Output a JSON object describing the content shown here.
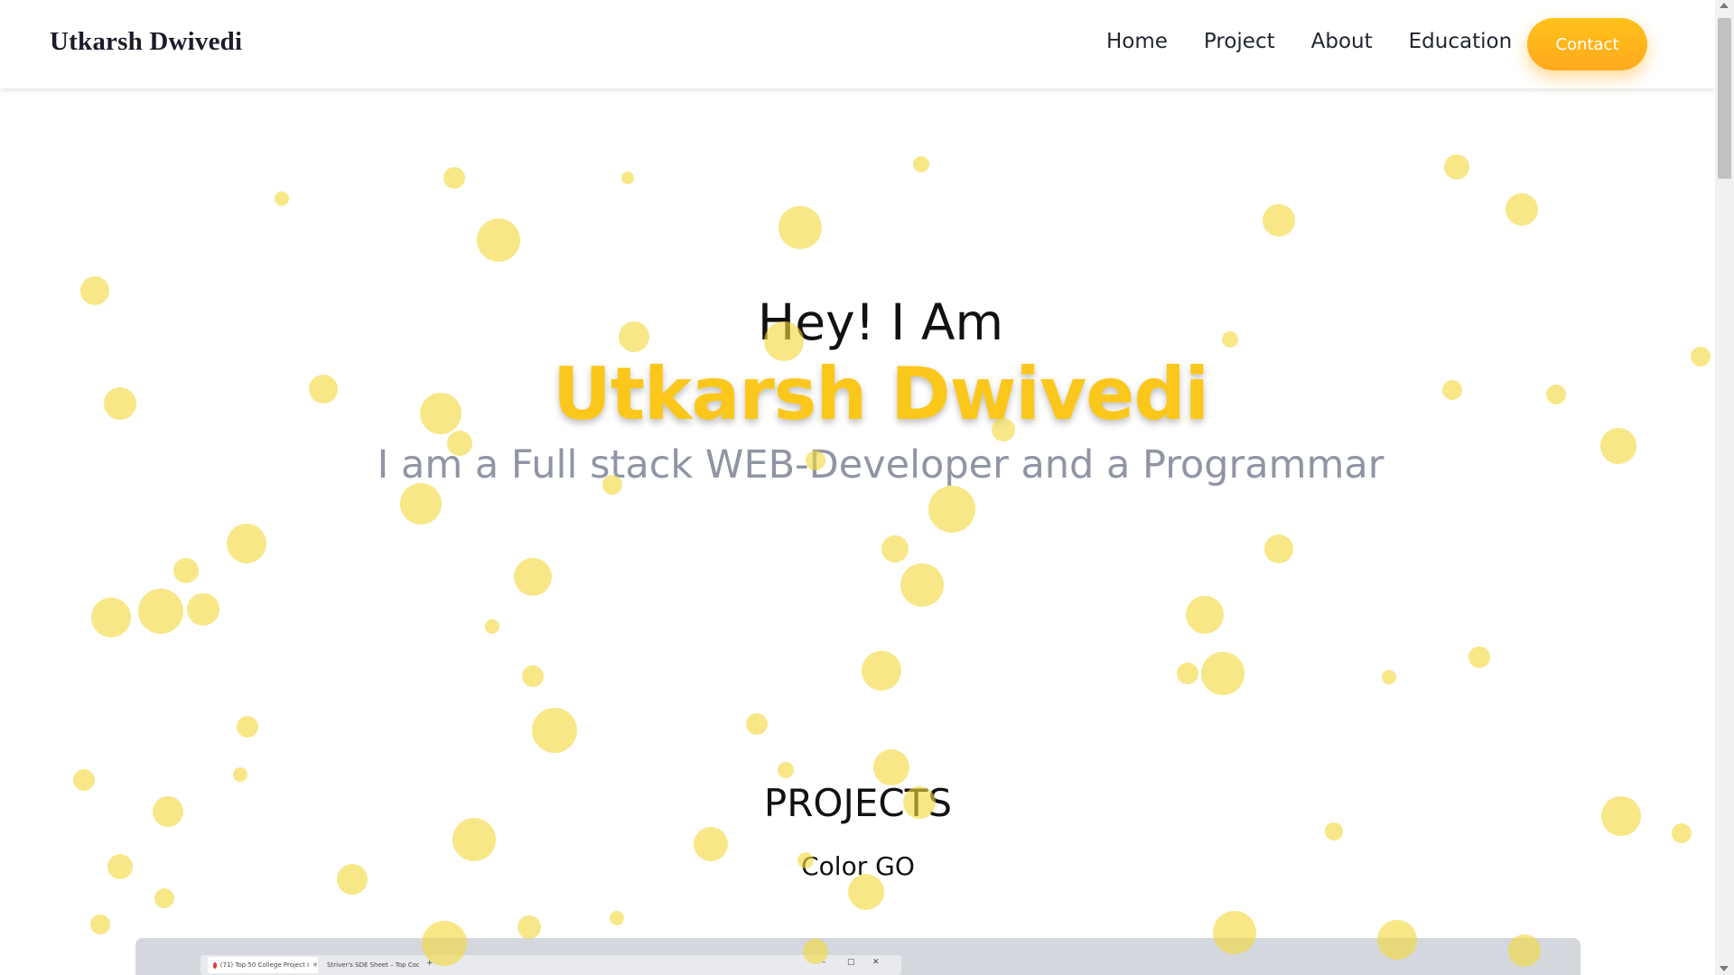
{
  "navbar": {
    "brand": "Utkarsh Dwivedi",
    "links": [
      "Home",
      "Project",
      "About",
      "Education"
    ],
    "contact_label": "Contact"
  },
  "hero": {
    "greeting": "Hey! I Am",
    "name": "Utkarsh Dwivedi",
    "tagline": "I am a Full stack WEB-Developer and a Programmar"
  },
  "projects": {
    "section_title": "PROJECTS",
    "items": [
      {
        "name": "Color GO",
        "preview_tabs": [
          "(71) Top 50 College Project I",
          "Striver's SDE Sheet – Top Codin"
        ]
      }
    ]
  },
  "colors": {
    "accent": "#fbc71a",
    "contact_gradient": [
      "#ffc21a",
      "#ffa91e"
    ],
    "bubble": "#f2d93e",
    "tagline": "#8f95a3"
  }
}
